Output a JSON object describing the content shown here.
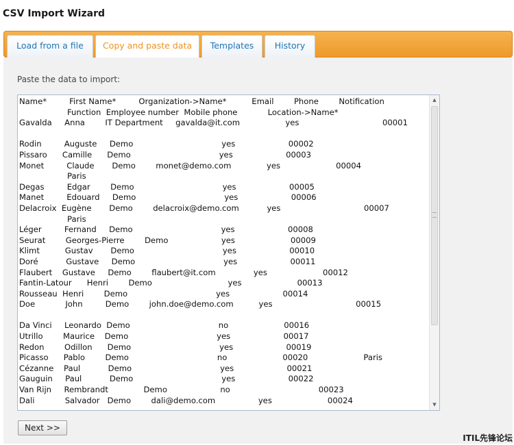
{
  "app": {
    "title": "CSV Import Wizard"
  },
  "tabs": [
    {
      "label": "Load from a file",
      "active": false
    },
    {
      "label": "Copy and paste data",
      "active": true
    },
    {
      "label": "Templates",
      "active": false
    },
    {
      "label": "History",
      "active": false
    }
  ],
  "main": {
    "prompt": "Paste the data to import:",
    "textarea_lines": [
      "Name*         First Name*         Organization->Name*          Email        Phone        Notification",
      "                   Function  Employee number  Mobile phone            Location->Name*",
      "Gavalda     Anna        IT Department     gavalda@it.com                  yes                                 00001",
      "",
      "Rodin         Auguste     Demo                                   yes                     00002",
      "Pissaro      Camille      Demo                                   yes                     00003",
      "Monet         Claude       Demo        monet@demo.com              yes                      00004",
      "                   Paris",
      "Degas         Edgar        Demo                                   yes                     00005",
      "Manet         Edouard     Demo                                   yes                     00006",
      "Delacroix  Eugène       Demo        delacroix@demo.com           yes                                 00007",
      "                   Paris",
      "Léger         Fernand     Demo                                   yes                     00008",
      "Seurat        Georges-Pierre        Demo                     yes                      00009",
      "Klimt          Gustav       Demo                                   yes                     00010",
      "Doré           Gustave     Demo                                   yes                     00011",
      "Flaubert    Gustave     Demo        flaubert@it.com               yes                      00012",
      "Fantin-Latour      Henri        Demo                              yes                      00013",
      "Rousseau  Henri        Demo                                   yes                     00014",
      "Doe            John         Demo        john.doe@demo.com          yes                                 00015",
      "",
      "Da Vinci     Leonardo  Demo                                   no                      00016",
      "Utrillo        Maurice    Demo                                   yes                     00017",
      "Redon        Odillon      Demo                                   yes                     00019",
      "Picasso      Pablo        Demo                                   no                      00020                      Paris",
      "Cézanne    Paul           Demo                                   yes                     00021",
      "Gauguin     Paul           Demo                                   yes                     00022",
      "Van Rijn     Rembrandt              Demo                     no                                   00023",
      "Dali            Salvador   Demo        dali@demo.com                 yes                      00024"
    ]
  },
  "buttons": {
    "next_label": "Next >>"
  },
  "watermark": "ITIL先锋论坛",
  "colors": {
    "tabbar_accent": "#f0a136",
    "active_tab_text": "#f0921e",
    "tab_text": "#1e76b8",
    "panel_bg": "#f1f1f1"
  },
  "icons": {
    "scroll_up": "scroll-up-arrow-icon",
    "scroll_down": "scroll-down-arrow-icon"
  }
}
